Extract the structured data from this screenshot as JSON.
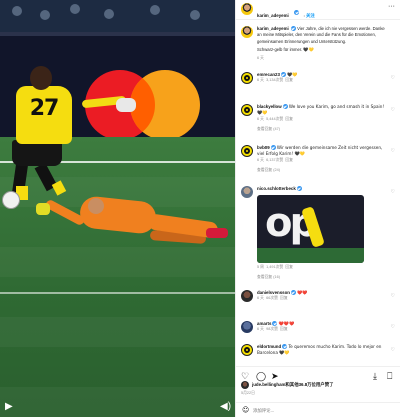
{
  "post": {
    "author": "karim_adeyemi",
    "follow_label": "关注"
  },
  "caption": {
    "author": "karim_adeyemi",
    "text": "Vier Jahre, die ich nie vergessen werde. Danke an meine Mitspieler, den Verein und die Fans für die Emotionen, gemeinsamen Erinnerungen und Unterstützung.",
    "text2": "Schwarz-gelb für immer.",
    "emoji": "🖤💛",
    "age": "6 天"
  },
  "comments": [
    {
      "user": "emrecan23",
      "verified": true,
      "text": "🖤💛",
      "age": "6 天",
      "likes": "3,134次赞",
      "reply": "回复",
      "avatar": "bvb"
    },
    {
      "user": "blackyellow",
      "verified": true,
      "text": "We love you Karim, go and smash it in Spain! 🖤💛",
      "age": "6 天",
      "likes": "5,444次赞",
      "reply": "回复",
      "more": "查看回复 (47)",
      "avatar": "bvb"
    },
    {
      "user": "bvb09",
      "verified": true,
      "text": "Wir werden die gemeinsame Zeit nicht vergessen, viel Erfolg Karim! 🖤💛",
      "age": "6 天",
      "likes": "6,137次赞",
      "reply": "回复",
      "more": "查看回复 (24)",
      "avatar": "bvb",
      "mention": "Wir werden die gemeinsame Zeit nicht vergessen, viel"
    },
    {
      "user": "nico.schlotterbeck",
      "verified": true,
      "text": "",
      "age": "5 周",
      "likes": "1,491次赞",
      "reply": "回复",
      "more": "查看回复 (16)",
      "avatar": "grey",
      "thumb_text": "op"
    },
    {
      "user": "danielsvensson",
      "verified": true,
      "text": "❤️❤️",
      "age": "6 天",
      "likes": "66次赞",
      "reply": "回复",
      "avatar": "dark"
    },
    {
      "user": "amarts",
      "verified": true,
      "text": "❤️❤️❤️",
      "age": "6 天",
      "likes": "98次赞",
      "reply": "回复",
      "avatar": "blue"
    },
    {
      "user": "eldortmund",
      "verified": true,
      "text": "Te queremos mucho Karim. Todo lo mejor en Barcelona 🖤💛",
      "age": "6 天",
      "likes": "327次赞",
      "reply": "回复",
      "more": "查看回复 (1)",
      "avatar": "bvb"
    }
  ],
  "likes_text": "jude.bellingham和其他36.8万位用户赞了",
  "likes_date": "5月22日",
  "add_comment_placeholder": "添加评论...",
  "icons": {
    "heart": "heart-icon",
    "comment": "comment-icon",
    "share": "share-icon",
    "save": "bookmark-icon",
    "more": "more-icon",
    "play": "play-icon",
    "volume": "volume-icon",
    "emoji": "emoji-icon"
  }
}
